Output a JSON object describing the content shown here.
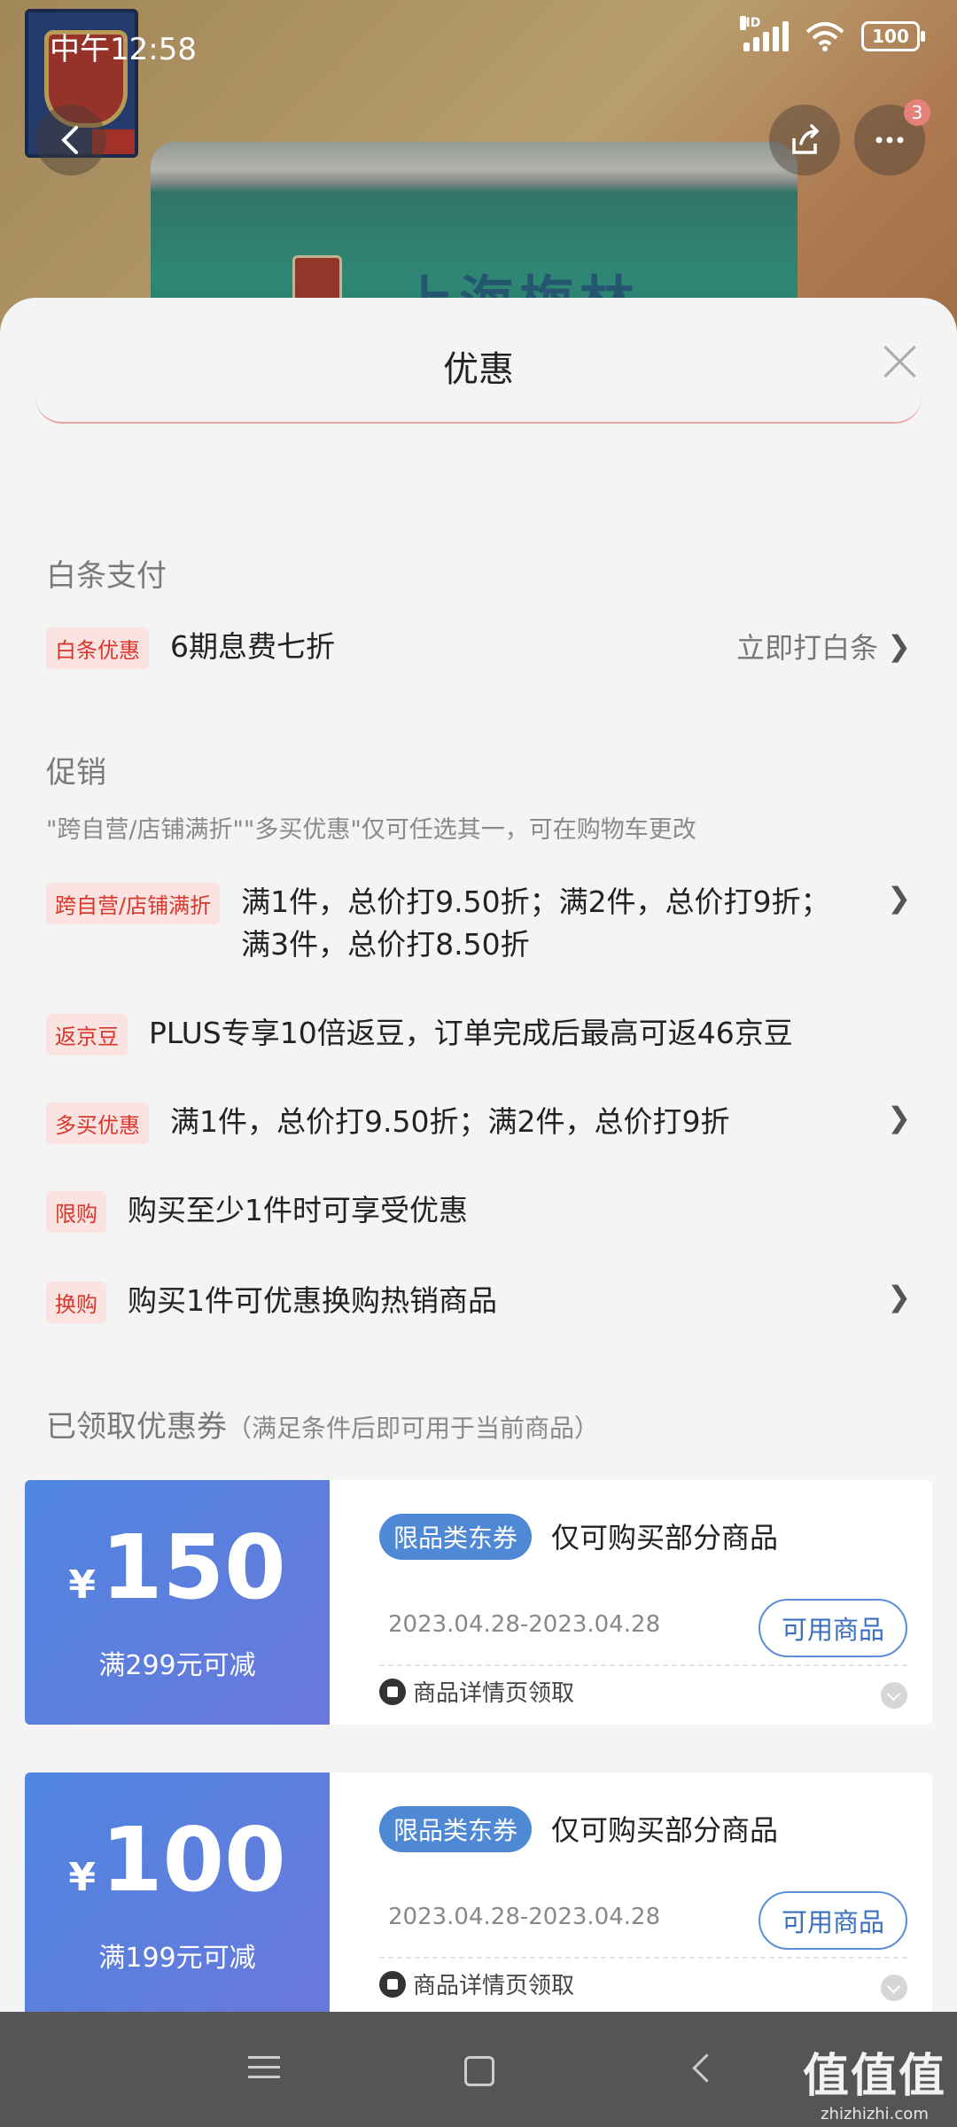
{
  "status_bar": {
    "time": "中午12:58",
    "network": "HD",
    "battery": "100"
  },
  "header": {
    "more_badge": "3"
  },
  "background": {
    "product_text": "上海梅林"
  },
  "sheet": {
    "title": "优惠"
  },
  "baitiao": {
    "heading": "白条支付",
    "tag": "白条优惠",
    "text": "6期息费七折",
    "action": "立即打白条"
  },
  "promotion": {
    "heading": "促销",
    "note": "\"跨自营/店铺满折\"\"多买优惠\"仅可任选其一，可在购物车更改",
    "items": [
      {
        "tag": "跨自营/店铺满折",
        "text": "满1件，总价打9.50折；满2件，总价打9折；满3件，总价打8.50折",
        "has_arrow": true
      },
      {
        "tag": "返京豆",
        "text": "PLUS专享10倍返豆，订单完成后最高可返46京豆",
        "has_arrow": false
      },
      {
        "tag": "多买优惠",
        "text": "满1件，总价打9.50折；满2件，总价打9折",
        "has_arrow": true
      },
      {
        "tag": "限购",
        "text": "购买至少1件时可享受优惠",
        "has_arrow": false
      },
      {
        "tag": "换购",
        "text": "购买1件可优惠换购热销商品",
        "has_arrow": true
      }
    ]
  },
  "coupons_section": {
    "heading": "已领取优惠券",
    "subheading": "（满足条件后即可用于当前商品）",
    "coupons": [
      {
        "currency": "¥",
        "amount": "150",
        "condition": "满299元可减",
        "type": "限品类东券",
        "desc": "仅可购买部分商品",
        "date": "2023.04.28-2023.04.28",
        "button": "可用商品",
        "source": "商品详情页领取"
      },
      {
        "currency": "¥",
        "amount": "100",
        "condition": "满199元可减",
        "type": "限品类东券",
        "desc": "仅可购买部分商品",
        "date": "2023.04.28-2023.04.28",
        "button": "可用商品",
        "source": "商品详情页领取"
      }
    ]
  },
  "watermark": {
    "big": "值值值",
    "small": "zhizhizhi.com"
  },
  "colors": {
    "accent_red": "#d9362c",
    "coupon_blue": "#4f86e0",
    "tag_bg": "#fbe3e1"
  }
}
